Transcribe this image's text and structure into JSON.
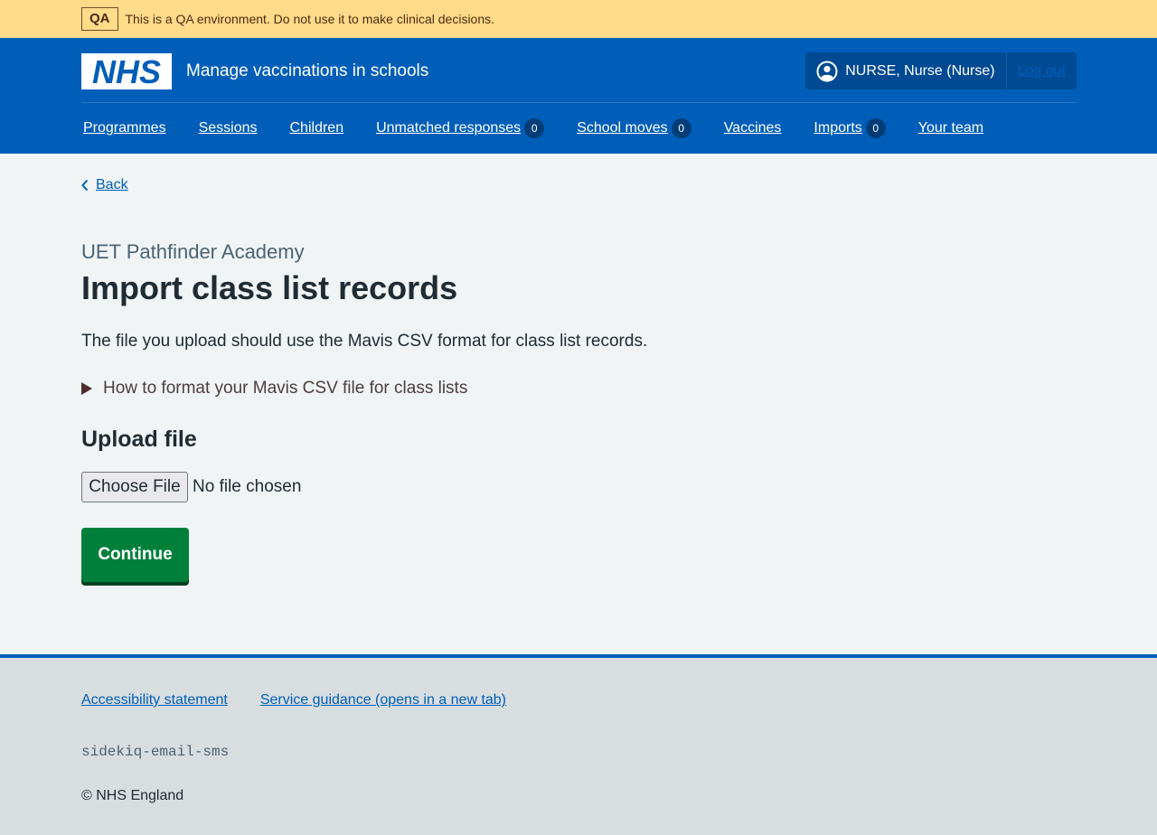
{
  "qa_banner": {
    "tag": "QA",
    "message": "This is a QA environment. Do not use it to make clinical decisions."
  },
  "header": {
    "logo_text": "NHS",
    "service_name": "Manage vaccinations in schools",
    "account": {
      "user_label": "NURSE, Nurse (Nurse)",
      "user_icon": "user-circle-icon",
      "logout_label": "Log out"
    },
    "nav": [
      {
        "label": "Programmes"
      },
      {
        "label": "Sessions"
      },
      {
        "label": "Children"
      },
      {
        "label": "Unmatched responses",
        "count": "0"
      },
      {
        "label": "School moves",
        "count": "0"
      },
      {
        "label": "Vaccines"
      },
      {
        "label": "Imports",
        "count": "0"
      },
      {
        "label": "Your team"
      }
    ]
  },
  "main": {
    "back_label": "Back",
    "caption": "UET Pathfinder Academy",
    "title": "Import class list records",
    "intro": "The file you upload should use the Mavis CSV format for class list records.",
    "details_summary": "How to format your Mavis CSV file for class lists",
    "upload_heading": "Upload file",
    "file_input": {
      "button_label": "Choose File",
      "status": "No file chosen"
    },
    "continue_label": "Continue"
  },
  "footer": {
    "links": [
      {
        "label": "Accessibility statement"
      },
      {
        "label": "Service guidance (opens in a new tab)"
      }
    ],
    "environment": "sidekiq-email-sms",
    "copyright": "© NHS England"
  },
  "colors": {
    "nhs_blue": "#005eb8",
    "qa_banner": "#ffdb8a",
    "continue_green": "#007f3b",
    "page_background": "#f0f4f5",
    "footer_background": "#d8dde0"
  }
}
